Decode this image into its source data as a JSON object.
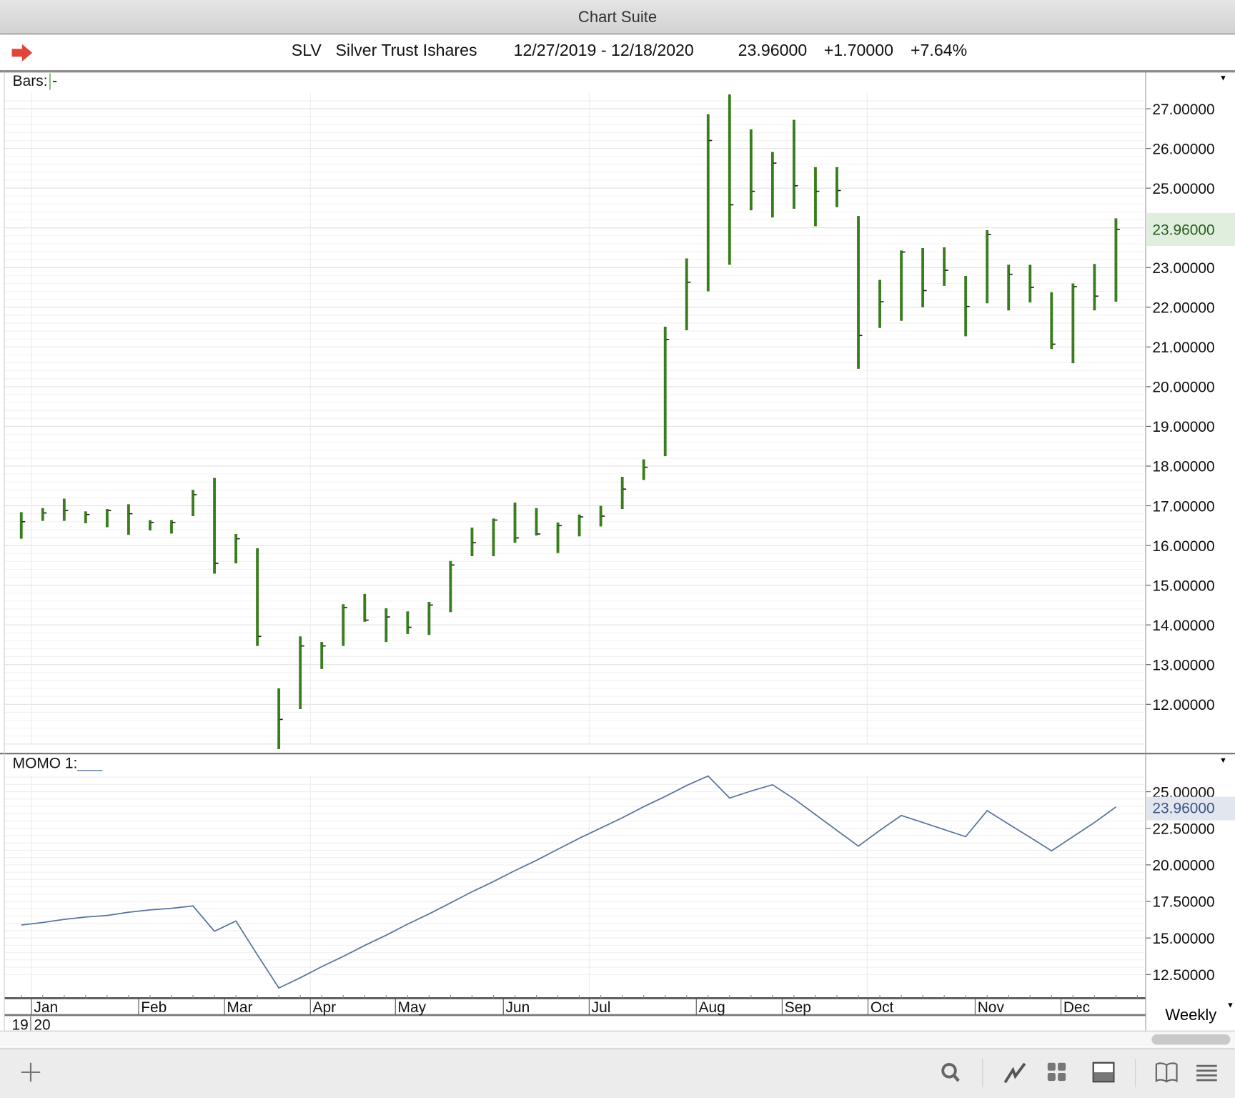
{
  "window": {
    "title": "Chart Suite"
  },
  "header": {
    "symbol": "SLV",
    "name": "Silver Trust Ishares",
    "date_range": "12/27/2019 - 12/18/2020",
    "last": "23.96000",
    "change": "+1.70000",
    "change_pct": "+7.64%",
    "arrow_color": "#e0463a"
  },
  "price_pane": {
    "label": "Bars:",
    "label_suffix": "-",
    "last_label": "23.96000",
    "last_bg": "#dfeedd"
  },
  "momo_pane": {
    "label": "MOMO 1:",
    "label_suffix": "___",
    "last_label": "23.96000",
    "last_bg": "#e2e6ee"
  },
  "x_axis": {
    "months": [
      "Jan",
      "Feb",
      "Mar",
      "Apr",
      "May",
      "Jun",
      "Jul",
      "Aug",
      "Sep",
      "Oct",
      "Nov",
      "Dec"
    ],
    "years": [
      "19",
      "20"
    ]
  },
  "period_select": {
    "value": "Weekly"
  },
  "toolbar": {
    "icons": [
      "add-icon",
      "search-icon",
      "line-chart-icon",
      "grid-icon",
      "panel-icon",
      "book-icon",
      "list-icon"
    ]
  },
  "chart_data": [
    {
      "type": "bar",
      "subtype": "ohlc-hlc",
      "title": "SLV",
      "bar_color": "#3a7d1e",
      "y_ticks": [
        "27.00000",
        "26.00000",
        "25.00000",
        "23.00000",
        "22.00000",
        "21.00000",
        "20.00000",
        "19.00000",
        "18.00000",
        "17.00000",
        "16.00000",
        "15.00000",
        "14.00000",
        "13.00000",
        "12.00000"
      ],
      "ylim": [
        10.8,
        27.3
      ],
      "x_tick_labels": [
        "Jan",
        "Feb",
        "Mar",
        "Apr",
        "May",
        "Jun",
        "Jul",
        "Aug",
        "Sep",
        "Oct",
        "Nov",
        "Dec"
      ],
      "grid": true,
      "high": [
        16.84,
        16.94,
        17.18,
        16.86,
        16.92,
        17.04,
        16.64,
        16.64,
        17.4,
        17.7,
        16.29,
        15.93,
        12.4,
        13.71,
        13.57,
        14.52,
        14.78,
        14.42,
        14.34,
        14.58,
        15.61,
        16.45,
        16.68,
        17.08,
        16.94,
        16.58,
        16.78,
        17.0,
        17.73,
        18.17,
        21.51,
        23.23,
        26.86,
        27.36,
        26.48,
        25.91,
        26.72,
        25.53,
        25.53,
        24.3,
        22.69,
        23.43,
        23.49,
        23.51,
        22.79,
        23.94,
        23.07,
        23.07,
        22.38,
        22.6,
        23.09,
        24.24
      ],
      "low": [
        16.17,
        16.62,
        16.62,
        16.56,
        16.46,
        16.27,
        16.38,
        16.3,
        16.74,
        15.29,
        15.55,
        13.47,
        10.87,
        11.88,
        12.89,
        13.47,
        14.08,
        13.57,
        13.77,
        13.75,
        14.32,
        15.73,
        15.73,
        16.07,
        16.25,
        15.81,
        16.23,
        16.48,
        16.92,
        17.65,
        18.25,
        21.42,
        22.4,
        23.07,
        24.44,
        24.26,
        24.48,
        24.04,
        24.52,
        20.45,
        21.48,
        21.66,
        22.0,
        22.54,
        21.27,
        22.1,
        21.92,
        22.12,
        20.95,
        20.59,
        21.92,
        22.14
      ],
      "close": [
        16.6,
        16.82,
        16.88,
        16.78,
        16.88,
        16.8,
        16.58,
        16.58,
        17.28,
        15.55,
        16.17,
        13.71,
        11.62,
        13.47,
        13.47,
        14.44,
        14.12,
        14.2,
        13.94,
        14.5,
        15.51,
        16.07,
        16.64,
        16.19,
        16.29,
        16.5,
        16.72,
        16.74,
        17.42,
        17.97,
        21.19,
        22.63,
        26.2,
        24.58,
        24.92,
        25.63,
        25.06,
        24.92,
        24.94,
        21.29,
        22.14,
        23.39,
        22.42,
        22.93,
        22.02,
        23.83,
        22.83,
        22.5,
        21.07,
        22.52,
        22.28,
        23.96
      ]
    },
    {
      "type": "line",
      "title": "MOMO 1",
      "line_color": "#5a74a0",
      "y_ticks": [
        "25.00000",
        "22.50000",
        "20.00000",
        "17.50000",
        "15.00000",
        "12.50000"
      ],
      "ylim": [
        11.0,
        27.0
      ],
      "grid": true,
      "values": [
        15.89,
        16.06,
        16.27,
        16.43,
        16.54,
        16.76,
        16.92,
        17.03,
        17.19,
        15.46,
        16.16,
        13.85,
        11.58,
        12.28,
        13.04,
        13.74,
        14.49,
        15.19,
        15.95,
        16.65,
        17.4,
        18.16,
        18.86,
        19.61,
        20.31,
        21.07,
        21.82,
        22.52,
        23.22,
        23.98,
        24.68,
        25.43,
        26.08,
        24.57,
        25.05,
        25.48,
        24.52,
        23.44,
        22.36,
        21.28,
        22.36,
        23.38,
        22.9,
        22.41,
        21.93,
        23.71,
        22.79,
        21.88,
        20.96,
        21.93,
        22.9,
        23.96
      ]
    }
  ]
}
